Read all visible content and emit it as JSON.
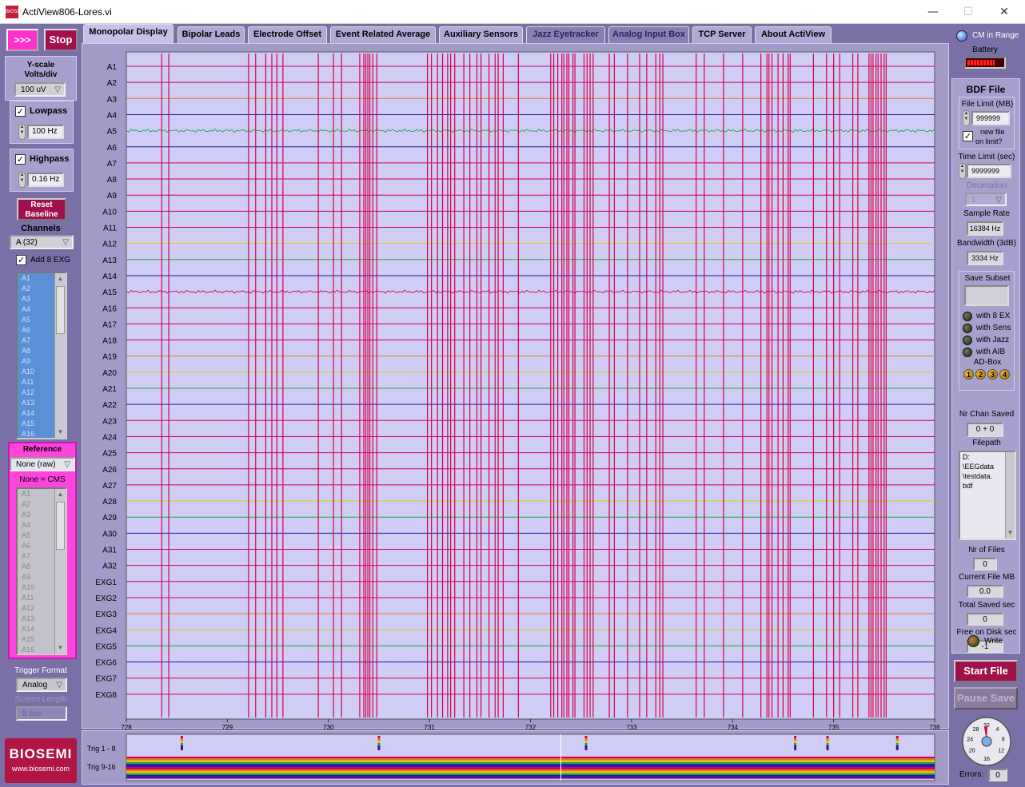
{
  "window": {
    "title": "ActiView806-Lores.vi",
    "icon_text": "BIOSEMI",
    "minimize": "—",
    "maximize": "☐",
    "close": "✕"
  },
  "left": {
    "run_label": ">>>",
    "stop_label": "Stop",
    "yscale_label": "Y-scale",
    "volts_label": "Volts/div",
    "yscale_value": "100 uV",
    "lowpass_label": "Lowpass",
    "lowpass_checked": "✓",
    "lowpass_value": "100 Hz",
    "highpass_label": "Highpass",
    "highpass_checked": "✓",
    "highpass_value": "0.16 Hz",
    "reset_label_1": "Reset",
    "reset_label_2": "Baseline",
    "channels_label": "Channels",
    "channels_value": "A (32)",
    "add_exg_checked": "✓",
    "add_exg_label": "Add  8 EXG",
    "channel_list": [
      "A1",
      "A2",
      "A3",
      "A4",
      "A5",
      "A6",
      "A7",
      "A8",
      "A9",
      "A10",
      "A11",
      "A12",
      "A13",
      "A14",
      "A15",
      "A16"
    ],
    "reference_label": "Reference",
    "reference_value": "None (raw)",
    "reference_note": "None = CMS",
    "reference_list": [
      "A1",
      "A2",
      "A3",
      "A4",
      "A5",
      "A6",
      "A7",
      "A8",
      "A9",
      "A10",
      "A11",
      "A12",
      "A13",
      "A14",
      "A15",
      "A16"
    ],
    "trigger_format_label": "Trigger Format",
    "trigger_format_value": "Analog",
    "screen_length_label": "Screen Length",
    "screen_length_value": "8 sec",
    "logo_text": "BIOSEMI",
    "logo_url": "www.biosemi.com"
  },
  "tabs": [
    {
      "label": "Monopolar Display",
      "state": "active"
    },
    {
      "label": "Bipolar Leads",
      "state": "normal"
    },
    {
      "label": "Electrode Offset",
      "state": "normal"
    },
    {
      "label": "Event Related Average",
      "state": "normal"
    },
    {
      "label": "Auxiliary Sensors",
      "state": "normal"
    },
    {
      "label": "Jazz Eyetracker",
      "state": "dim"
    },
    {
      "label": "Analog Input Box",
      "state": "dim"
    },
    {
      "label": "TCP Server",
      "state": "normal"
    },
    {
      "label": "About ActiView",
      "state": "normal"
    }
  ],
  "plot": {
    "channels": [
      "A1",
      "A2",
      "A3",
      "A4",
      "A5",
      "A6",
      "A7",
      "A8",
      "A9",
      "A10",
      "A11",
      "A12",
      "A13",
      "A14",
      "A15",
      "A16",
      "A17",
      "A18",
      "A19",
      "A20",
      "A21",
      "A22",
      "A23",
      "A24",
      "A25",
      "A26",
      "A27",
      "A28",
      "A29",
      "A30",
      "A31",
      "A32",
      "EXG1",
      "EXG2",
      "EXG3",
      "EXG4",
      "EXG5",
      "EXG6",
      "EXG7",
      "EXG8"
    ],
    "channel_colors": [
      "#d4004a",
      "#d4004a",
      "#e07818",
      "#1a1aa0",
      "#20a040",
      "#1a1aa0",
      "#d4004a",
      "#d4004a",
      "#d4004a",
      "#d4004a",
      "#d4004a",
      "#e0d000",
      "#20a040",
      "#1a1aa0",
      "#d4004a",
      "#d4004a",
      "#d4004a",
      "#d4004a",
      "#e07818",
      "#e0d000",
      "#20a040",
      "#1a1aa0",
      "#d4004a",
      "#d4004a",
      "#d4004a",
      "#d4004a",
      "#d4004a",
      "#e0d000",
      "#20a040",
      "#1a1aa0",
      "#d4004a",
      "#d4004a",
      "#d4004a",
      "#d4004a",
      "#e07818",
      "#e0d000",
      "#20a040",
      "#1a1aa0",
      "#d4004a",
      "#d4004a"
    ],
    "x_ticks": [
      "728",
      "729",
      "730",
      "731",
      "732",
      "733",
      "734",
      "735",
      "736"
    ],
    "xlim": [
      728,
      736
    ],
    "background": "#cfcdf5",
    "spike_times": [
      728.35,
      728.42,
      729.21,
      729.28,
      729.38,
      729.44,
      729.49,
      729.55,
      729.9,
      730.05,
      730.13,
      730.31,
      730.35,
      730.37,
      730.39,
      730.41,
      730.44,
      730.48,
      730.98,
      731.02,
      731.08,
      731.13,
      731.18,
      731.21,
      731.25,
      731.34,
      731.4,
      731.47,
      731.51,
      731.59,
      731.65,
      731.68,
      731.73,
      731.88,
      732.2,
      732.23,
      732.27,
      732.31,
      732.33,
      732.36,
      732.38,
      732.42,
      732.44,
      732.53,
      732.56,
      732.59,
      732.62,
      732.78,
      732.83,
      732.96,
      733.08,
      733.15,
      733.24,
      733.28,
      733.31,
      733.64,
      733.72,
      733.91,
      734.1,
      734.28,
      734.34,
      734.36,
      734.39,
      734.45,
      734.5,
      734.55,
      734.57,
      734.8,
      734.93,
      735.0,
      735.06,
      735.19,
      735.24,
      735.35,
      735.37,
      735.39,
      735.42,
      735.44,
      735.47,
      735.5,
      735.52
    ],
    "active_channels": {
      "A5": "#20a040",
      "A15": "#d4004a"
    }
  },
  "triggers": {
    "trig1_label": "Trig 1 - 8",
    "trig2_label": "Trig 9-16",
    "marker_times": [
      728.55,
      730.5,
      732.55,
      734.62,
      734.94,
      735.63
    ],
    "band_colors": [
      "#d4004a",
      "#e07818",
      "#e0d000",
      "#20a040",
      "#1a1aa0",
      "#6a00a0",
      "#d4004a",
      "#e07818",
      "#e0d000",
      "#20a040",
      "#1a1aa0",
      "#6a00a0"
    ]
  },
  "right": {
    "cm_label": "CM in Range",
    "battery_label": "Battery",
    "bdf_label": "BDF File",
    "file_limit_label": "File Limit (MB)",
    "file_limit_value": "999999",
    "new_file_checked": "✓",
    "new_file_label_1": "new file",
    "new_file_label_2": "on limit?",
    "time_limit_label": "Time Limit (sec)",
    "time_limit_value": "9999999",
    "decimation_label": "Decimation",
    "decimation_value": "1",
    "sample_rate_label": "Sample Rate",
    "sample_rate_value": "16384 Hz",
    "bandwidth_label": "Bandwidth (3dB)",
    "bandwidth_value": "3334  Hz",
    "save_subset_label": "Save Subset",
    "with_8ex": "with 8 EX",
    "with_sens": "with Sens",
    "with_jazz": "with Jazz",
    "with_aib": "with AIB",
    "adbox_label": "AD-Box",
    "adbox_buttons": [
      "1",
      "2",
      "3",
      "4"
    ],
    "nr_chan_saved_label": "Nr Chan Saved",
    "nr_chan_saved_value": "0 + 0",
    "filepath_label": "Filepath",
    "filepath_lines": [
      "D:",
      "\\EEGdata",
      "\\testdata.",
      "bdf"
    ],
    "nr_files_label": "Nr of Files",
    "nr_files_value": "0",
    "current_file_label": "Current File MB",
    "current_file_value": "0.0",
    "total_saved_label": "Total Saved sec",
    "total_saved_value": "0",
    "free_disk_label": "Free on Disk sec",
    "free_disk_value": "-1",
    "write_label": "Write",
    "start_file_label": "Start File",
    "pause_save_label": "Pause Save",
    "dial_labels": [
      "32",
      "28",
      "4",
      "24",
      "8",
      "20",
      "12",
      "16"
    ],
    "errors_label": "Errors:",
    "errors_value": "0"
  }
}
